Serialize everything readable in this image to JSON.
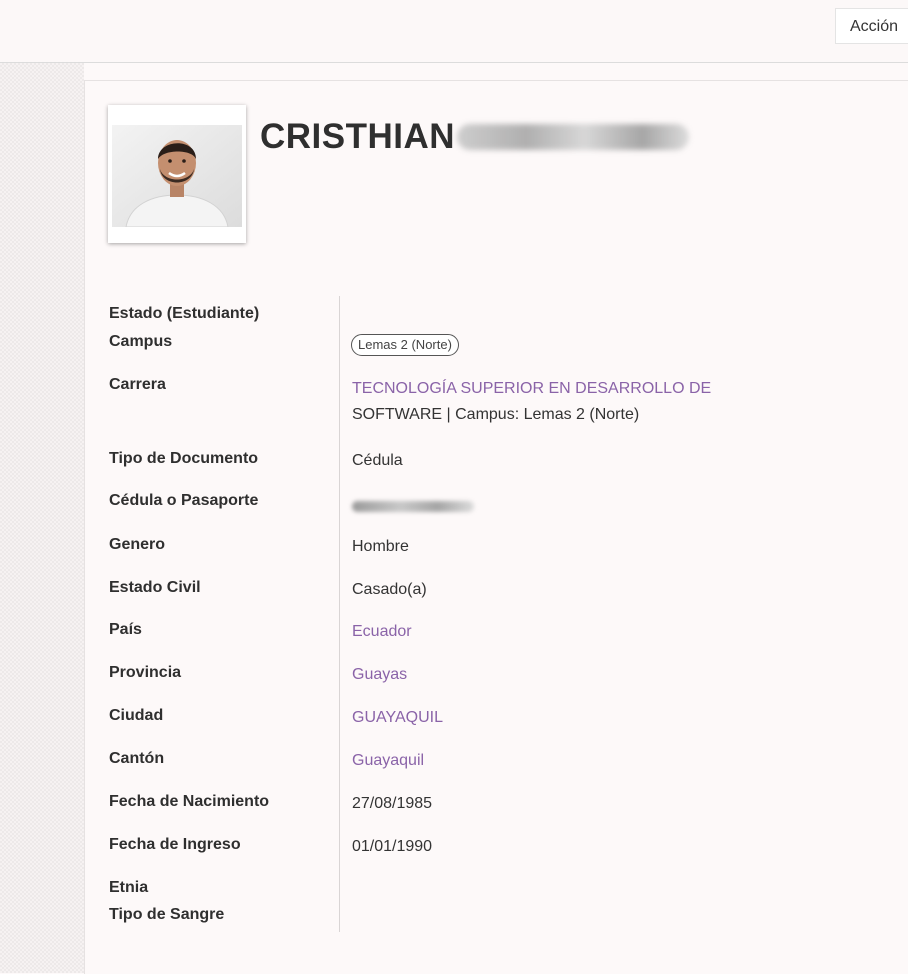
{
  "header": {
    "action_label": "Acción"
  },
  "profile": {
    "name": "CRISTHIAN"
  },
  "fields": {
    "estado_label": "Estado (Estudiante)",
    "campus_label": "Campus",
    "campus_value": "Lemas 2 (Norte)",
    "carrera_label": "Carrera",
    "carrera_link": "TECNOLOGÍA SUPERIOR EN DESARROLLO DE",
    "carrera_rest": "SOFTWARE | Campus: Lemas 2 (Norte)",
    "tipo_doc_label": "Tipo de Documento",
    "tipo_doc_value": "Cédula",
    "cedula_label": "Cédula o Pasaporte",
    "genero_label": "Genero",
    "genero_value": "Hombre",
    "estado_civil_label": "Estado Civil",
    "estado_civil_value": "Casado(a)",
    "pais_label": "País",
    "pais_value": "Ecuador",
    "provincia_label": "Provincia",
    "provincia_value": "Guayas",
    "ciudad_label": "Ciudad",
    "ciudad_value": "GUAYAQUIL",
    "canton_label": "Cantón",
    "canton_value": "Guayaquil",
    "fecha_nac_label": "Fecha de Nacimiento",
    "fecha_nac_value": "27/08/1985",
    "fecha_ing_label": "Fecha de Ingreso",
    "fecha_ing_value": "01/01/1990",
    "etnia_label": "Etnia",
    "sangre_label": "Tipo de Sangre"
  },
  "colors": {
    "link": "#8a63a8",
    "label": "#2f2f2f"
  },
  "icons": {
    "avatar": "user-photo"
  }
}
